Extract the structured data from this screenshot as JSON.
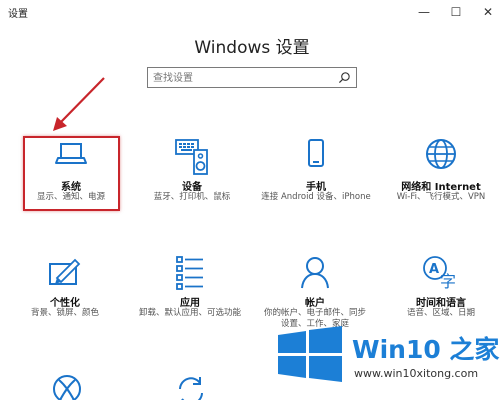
{
  "window": {
    "title": "设置",
    "minimize_glyph": "—",
    "maximize_glyph": "☐",
    "close_glyph": "✕"
  },
  "page_title": "Windows 设置",
  "search": {
    "placeholder": "查找设置"
  },
  "tiles": [
    {
      "label": "系统",
      "desc": "显示、通知、电源",
      "icon": "laptop-icon"
    },
    {
      "label": "设备",
      "desc": "蓝牙、打印机、鼠标",
      "icon": "devices-icon"
    },
    {
      "label": "手机",
      "desc": "连接 Android 设备、iPhone",
      "icon": "phone-icon"
    },
    {
      "label": "网络和 Internet",
      "desc": "Wi-Fi、飞行模式、VPN",
      "icon": "globe-icon"
    },
    {
      "label": "个性化",
      "desc": "背景、锁屏、颜色",
      "icon": "personalization-icon"
    },
    {
      "label": "应用",
      "desc": "卸载、默认应用、可选功能",
      "icon": "apps-icon"
    },
    {
      "label": "帐户",
      "desc": "你的帐户、电子邮件、同步设置、工作、家庭",
      "icon": "account-icon"
    },
    {
      "label": "时间和语言",
      "desc": "语音、区域、日期",
      "icon": "time-language-icon"
    }
  ],
  "watermark": {
    "name": "Win10 之家",
    "url": "www.win10xitong.com"
  },
  "colors": {
    "accent": "#1a73c9",
    "highlight": "#c8252b",
    "watermark_blue": "#1c7fd6"
  }
}
